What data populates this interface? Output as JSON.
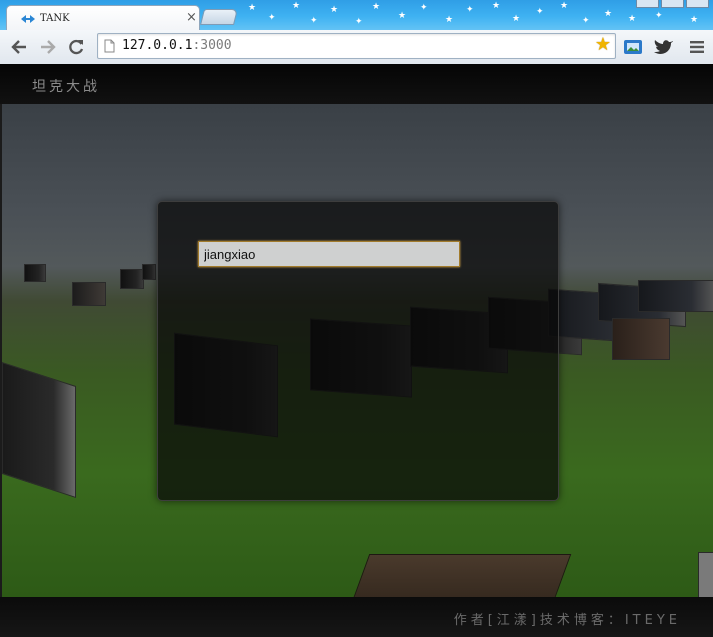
{
  "browser": {
    "tab_title": "TANK",
    "url_host": "127.0.0.1",
    "url_port": ":3000"
  },
  "page": {
    "site_title": "坦克大战",
    "footer_author": "作者[江漾]技术博客：ITEYE"
  },
  "login": {
    "name_value": "jiangxiao"
  }
}
